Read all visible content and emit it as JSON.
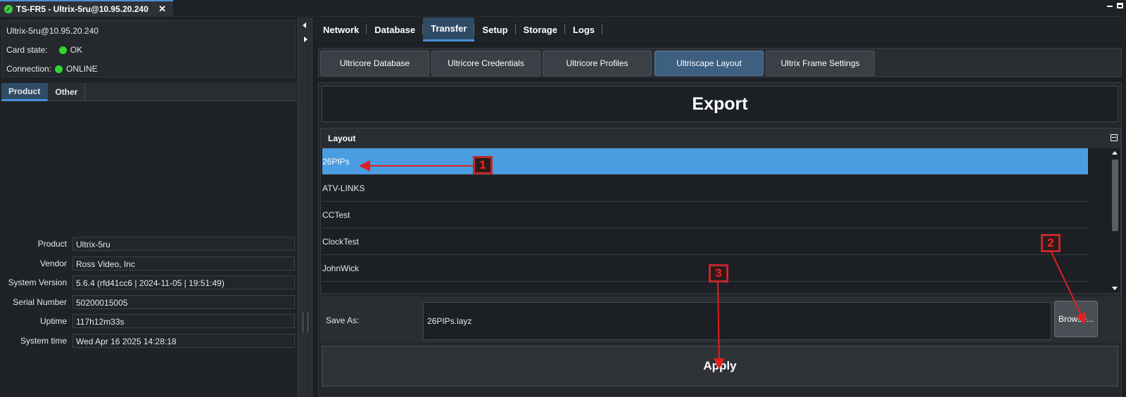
{
  "titlebar": {
    "tab_title": "TS-FR5 - Ultrix-5ru@10.95.20.240",
    "close_glyph": "✕",
    "status_icon": "check-circle-icon"
  },
  "left": {
    "device": "Ultrix-5ru@10.95.20.240",
    "card_state_label": "Card state:",
    "card_state_value": "OK",
    "connection_label": "Connection:",
    "connection_value": "ONLINE",
    "status_color": "#2fd62f",
    "tabs": [
      {
        "label": "Product",
        "active": true
      },
      {
        "label": "Other",
        "active": false
      }
    ],
    "properties": [
      {
        "label": "Product",
        "value": "Ultrix-5ru"
      },
      {
        "label": "Vendor",
        "value": "Ross Video, Inc"
      },
      {
        "label": "System Version",
        "value": "5.6.4 (rfd41cc6 | 2024-11-05 | 19:51:49)"
      },
      {
        "label": "Serial Number",
        "value": "50200015005"
      },
      {
        "label": "Uptime",
        "value": "117h12m33s"
      },
      {
        "label": "System time",
        "value": "Wed Apr 16 2025  14:28:18"
      }
    ]
  },
  "main": {
    "tabs": [
      "Network",
      "Database",
      "Transfer",
      "Setup",
      "Storage",
      "Logs"
    ],
    "active_tab": "Transfer",
    "subtabs": [
      "Ultricore Database",
      "Ultricore Credentials",
      "Ultricore Profiles",
      "Ultriscape Layout",
      "Ultrix Frame Settings"
    ],
    "active_subtab": "Ultriscape Layout",
    "export_title": "Export",
    "table_header": "Layout",
    "layouts": [
      "26PIPs",
      "ATV-LINKS",
      "CCTest",
      "ClockTest",
      "JohnWick"
    ],
    "selected_layout": "26PIPs",
    "save_as_label": "Save As:",
    "save_as_value": "26PIPs.layz",
    "browse_label": "Browse...",
    "apply_label": "Apply",
    "accent_color": "#4a9de0"
  },
  "annotations": [
    "1",
    "2",
    "3"
  ]
}
